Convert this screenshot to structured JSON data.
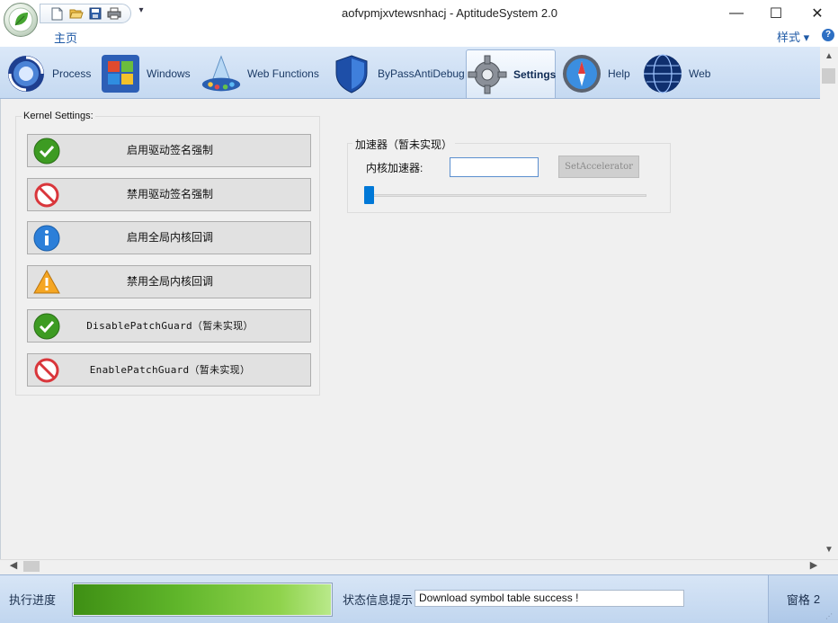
{
  "window": {
    "title": "aofvpmjxvtewsnhacj - AptitudeSystem 2.0",
    "minimize_label": "—",
    "maximize_label": "☐",
    "close_label": "✕"
  },
  "quick_access": {
    "icons": [
      "new-document-icon",
      "open-folder-icon",
      "save-icon",
      "print-icon"
    ],
    "more_label": "▾"
  },
  "menu": {
    "home_label": "主页",
    "style_label": "样式 ▾",
    "help_label": "?"
  },
  "ribbon": {
    "tabs": [
      {
        "label": "Process",
        "icon": "process-icon",
        "active": false
      },
      {
        "label": "Windows",
        "icon": "windows-icon",
        "active": false
      },
      {
        "label": "Web Functions",
        "icon": "web-functions-icon",
        "active": false
      },
      {
        "label": "ByPassAntiDebug",
        "icon": "shield-icon",
        "active": false
      },
      {
        "label": "Settings",
        "icon": "gear-icon",
        "active": true
      },
      {
        "label": "Help",
        "icon": "compass-icon",
        "active": false
      },
      {
        "label": "Web",
        "icon": "globe-icon",
        "active": false
      }
    ]
  },
  "kernel_settings": {
    "group_label": "Kernel Settings:",
    "buttons": [
      {
        "label": "启用驱动签名强制",
        "icon": "check-icon"
      },
      {
        "label": "禁用驱动签名强制",
        "icon": "prohibited-icon"
      },
      {
        "label": "启用全局内核回调",
        "icon": "info-icon"
      },
      {
        "label": "禁用全局内核回调",
        "icon": "warning-icon"
      },
      {
        "label": "DisablePatchGuard（暂未实现）",
        "icon": "check-icon"
      },
      {
        "label": "EnablePatchGuard（暂未实现）",
        "icon": "prohibited-icon"
      }
    ]
  },
  "accelerator": {
    "group_label": "加速器（暂未实现）",
    "field_label": "内核加速器:",
    "input_value": "",
    "button_label": "SetAccelerator",
    "slider_value": 0
  },
  "scrollbars": {
    "up": "▲",
    "down": "▼",
    "left": "◀",
    "right": "▶"
  },
  "status": {
    "progress_label": "执行进度",
    "progress_value": 1.0,
    "info_label": "状态信息提示",
    "info_text": "Download symbol table success !",
    "pane_label": "窗格",
    "pane_count": "2"
  },
  "colors": {
    "accent": "#1f5aa6",
    "ribbon_bg": "#c5d9f1",
    "progress_green": "#5fb52a",
    "slider_blue": "#0078d7"
  }
}
